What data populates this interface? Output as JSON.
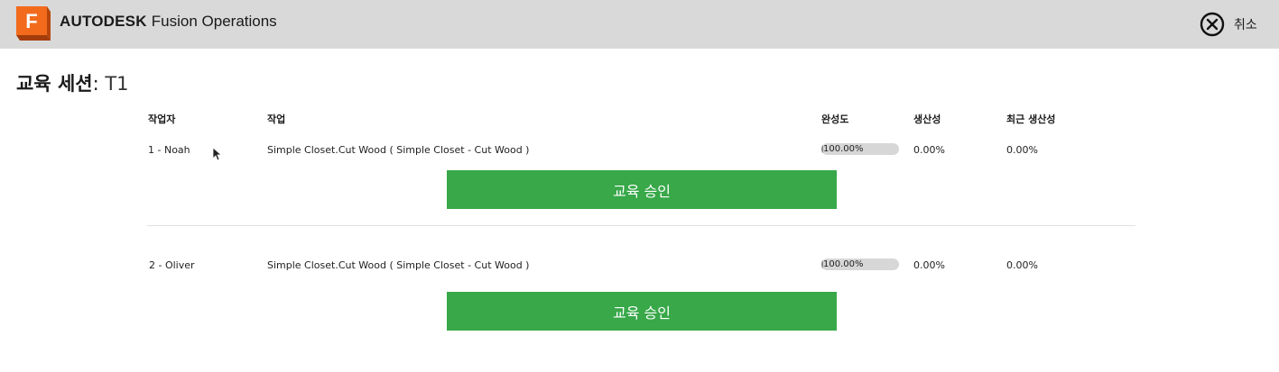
{
  "header": {
    "logo_letter": "F",
    "brand_bold": "AUTODESK",
    "brand_product": "Fusion Operations",
    "cancel_label": "취소",
    "logo_color": "#f26b1d"
  },
  "session": {
    "title_label": "교육 세션",
    "separator": ": ",
    "title_value": "T1"
  },
  "table": {
    "columns": {
      "worker": "작업자",
      "task": "작업",
      "completion": "완성도",
      "productivity": "생산성",
      "recent_productivity": "최근 생산성"
    },
    "rows": [
      {
        "worker": "1 - Noah",
        "task": "Simple Closet.Cut Wood ( Simple Closet - Cut Wood )",
        "completion": "100.00%",
        "completion_fraction": 1.0,
        "productivity": "0.00%",
        "recent_productivity": "0.00%",
        "approve_label": "교육 승인"
      },
      {
        "worker": "2 - Oliver",
        "task": "Simple Closet.Cut Wood ( Simple Closet - Cut Wood )",
        "completion": "100.00%",
        "completion_fraction": 1.0,
        "productivity": "0.00%",
        "recent_productivity": "0.00%",
        "approve_label": "교육 승인"
      }
    ]
  },
  "colors": {
    "topbar_bg": "#d9d9d9",
    "approve_button": "#38a849"
  }
}
